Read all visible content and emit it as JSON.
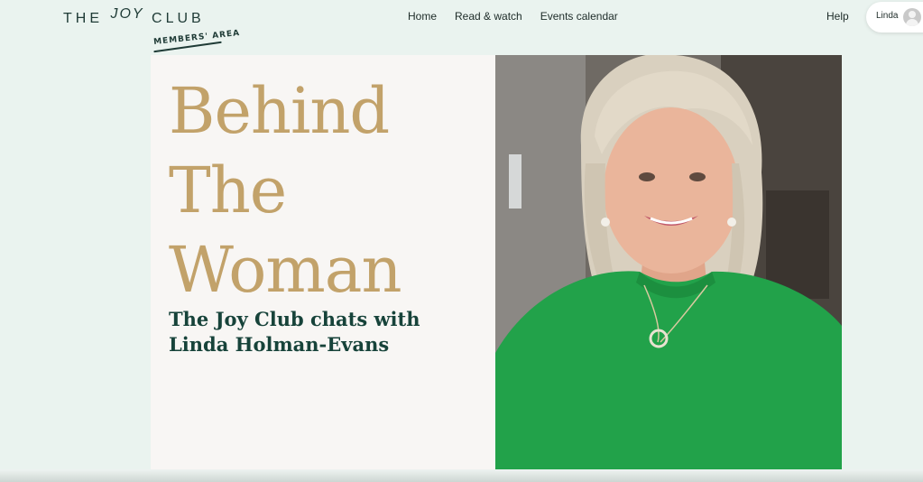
{
  "header": {
    "logo_main_left": "THE",
    "logo_main_joy": "JOY",
    "logo_main_right": "CLUB",
    "logo_sub": "MEMBERS' AREA",
    "nav": [
      "Home",
      "Read & watch",
      "Events calendar"
    ],
    "help": "Help",
    "user_name": "Linda"
  },
  "hero": {
    "title_lines": [
      "Behind",
      "The",
      "Woman"
    ],
    "subtitle_lines": [
      "The Joy Club chats with",
      "Linda Holman-Evans"
    ],
    "photo_subject": "portrait of woman with long blonde hair in green sweater"
  },
  "colors": {
    "accent_gold": "#c2a26a",
    "subtitle_green": "#17433a",
    "page_bg": "#eaf3ef",
    "sweater_green": "#22a24a"
  }
}
